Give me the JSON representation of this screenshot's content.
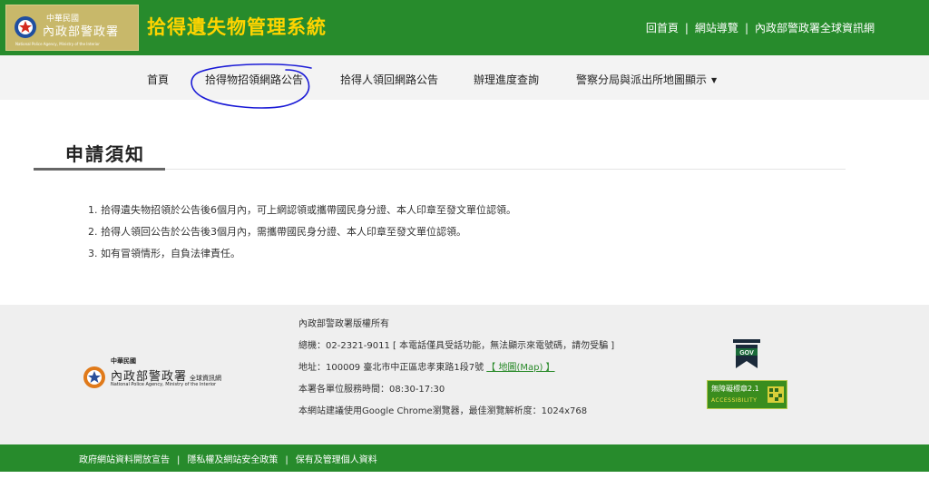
{
  "header": {
    "logo": {
      "line1": "中華民國",
      "line2": "內政部警政署",
      "line3": "National Police Agency, Ministry of the Interior"
    },
    "title": "拾得遺失物管理系統",
    "links": [
      "回首頁",
      "網站導覽",
      "內政部警政署全球資訊網"
    ],
    "separator": "|"
  },
  "nav": {
    "items": [
      "首頁",
      "拾得物招領網路公告",
      "拾得人領回網路公告",
      "辦理進度查詢",
      "警察分局與派出所地圖顯示"
    ],
    "caret": "▼"
  },
  "main": {
    "section_title": "申請須知",
    "notices": [
      "1. 拾得遺失物招領於公告後6個月內，可上網認領或攜帶國民身分證、本人印章至發文單位認領。",
      "2. 拾得人領回公告於公告後3個月內，需攜帶國民身分證、本人印章至發文單位認領。",
      "3. 如有冒領情形，自負法律責任。"
    ]
  },
  "footer": {
    "logo": {
      "line1": "中華民國",
      "line2": "內政部警政署",
      "line2_suffix": "全球資訊網",
      "line3": "National Police Agency, Ministry of the Interior"
    },
    "copyright": "內政部警政署版權所有",
    "phone": "總機：02-2321-9011 [ 本電話僅具受話功能，無法顯示來電號碼，請勿受騙 ]",
    "address": "地址：100009 臺北市中正區忠孝東路1段7號",
    "map_link": "【 地圖(Map) 】",
    "hours": "本署各單位服務時間：08:30-17:30",
    "browser": "本網站建議使用Google Chrome瀏覽器，最佳瀏覽解析度：1024x768",
    "badges": {
      "gov": "GOV",
      "accessibility_title": "無障礙標章2.1",
      "accessibility_sub": "ACCESSIBILITY"
    }
  },
  "bottom_bar": {
    "links": [
      "政府網站資料開放宣告",
      "隱私權及網站安全政策",
      "保有及管理個人資料"
    ],
    "separator": "|"
  },
  "colors": {
    "brand_green": "#278b2c",
    "title_yellow": "#ffd400",
    "logo_gold": "#c8b86a",
    "annotation_blue": "#1a1ad6"
  }
}
